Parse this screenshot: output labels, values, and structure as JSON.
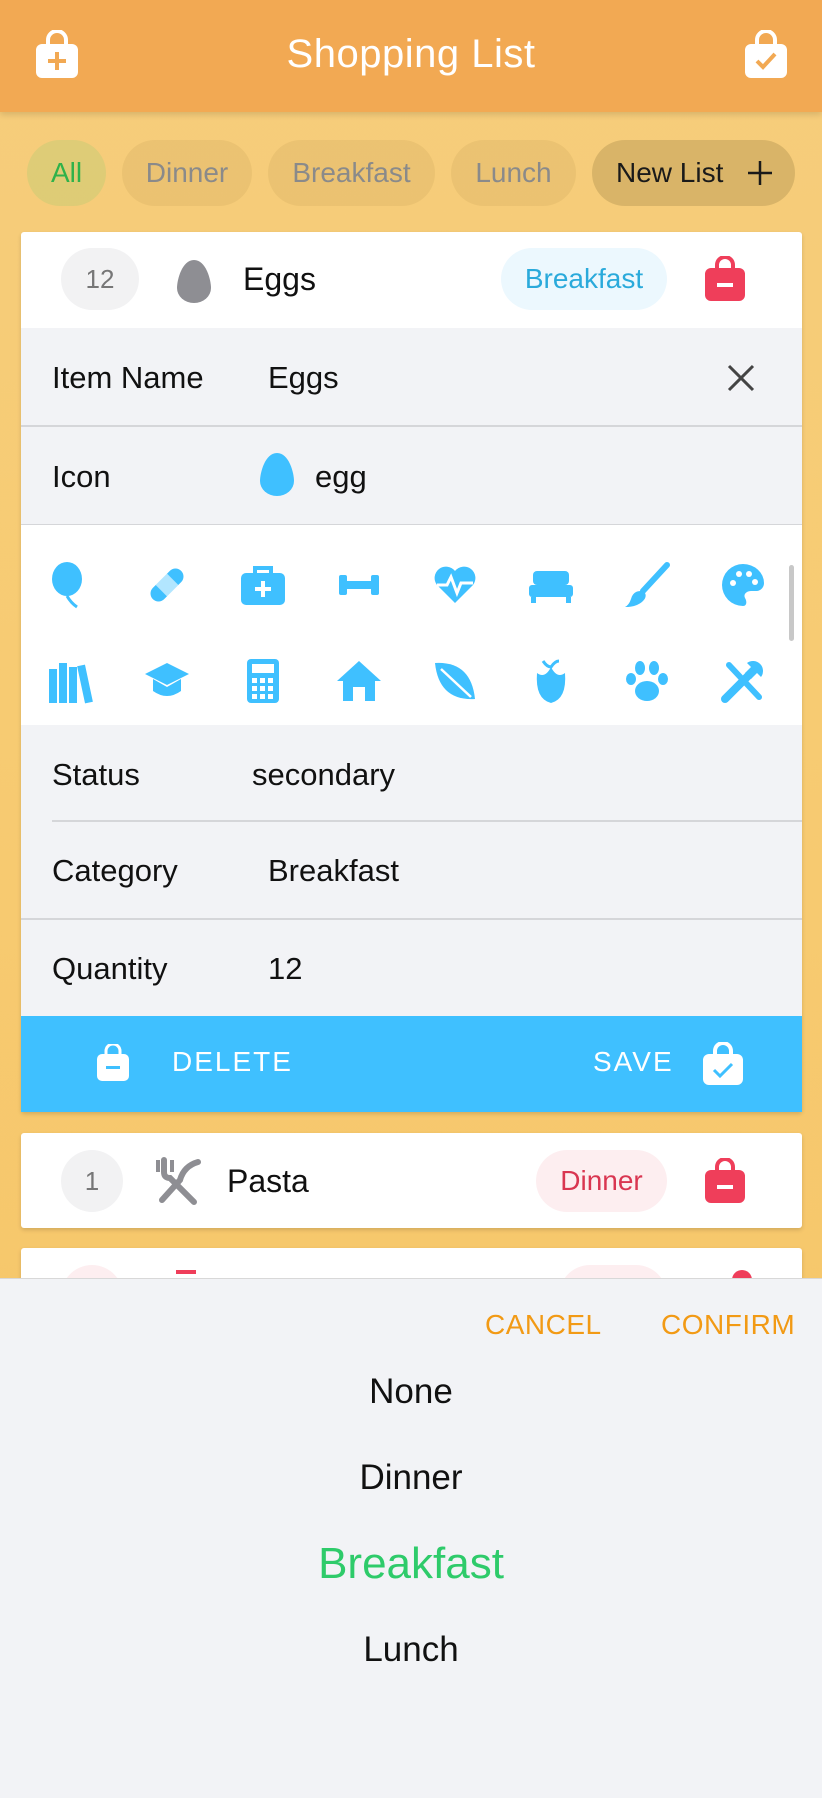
{
  "header": {
    "title": "Shopping List",
    "left_icon": "bag-plus-icon",
    "right_icon": "bag-check-icon"
  },
  "filters": {
    "chips": [
      "All",
      "Dinner",
      "Breakfast",
      "Lunch"
    ],
    "active": "All",
    "new_list_label": "New List"
  },
  "editing_item": {
    "quantity": "12",
    "name": "Eggs",
    "category": "Breakfast",
    "icon_name": "egg"
  },
  "edit_form": {
    "item_name_label": "Item Name",
    "item_name_value": "Eggs",
    "icon_label": "Icon",
    "icon_value": "egg",
    "status_label": "Status",
    "status_value": "secondary",
    "category_label": "Category",
    "category_value": "Breakfast",
    "quantity_label": "Quantity",
    "quantity_value": "12",
    "delete_label": "DELETE",
    "save_label": "SAVE"
  },
  "icon_grid": [
    "balloon-icon",
    "bandage-icon",
    "medkit-icon",
    "dumbbell-icon",
    "heartbeat-icon",
    "bed-icon",
    "brush-icon",
    "palette-icon",
    "books-icon",
    "graduation-cap-icon",
    "calculator-icon",
    "home-icon",
    "leaf-icon",
    "rose-icon",
    "paw-icon",
    "tools-icon"
  ],
  "items": [
    {
      "quantity": "1",
      "name": "Pasta",
      "category": "Dinner",
      "icon": "utensils-icon"
    }
  ],
  "picker": {
    "cancel_label": "CANCEL",
    "confirm_label": "CONFIRM",
    "options": [
      "None",
      "Dinner",
      "Breakfast",
      "Lunch"
    ],
    "selected": "Breakfast"
  },
  "colors": {
    "header": "#f2a953",
    "accent_blue": "#3fc0ff",
    "danger_red": "#ef3e5a",
    "picker_accent": "#f29a15",
    "selected_green": "#2ecb6a"
  }
}
